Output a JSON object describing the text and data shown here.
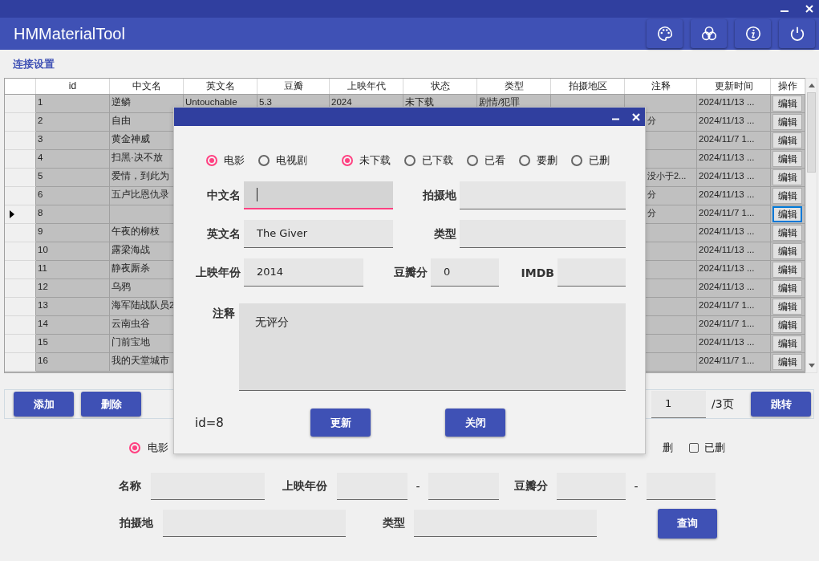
{
  "window": {
    "title": "HMMaterialTool"
  },
  "section_link": "连接设置",
  "table": {
    "columns": [
      "id",
      "中文名",
      "英文名",
      "豆瓣",
      "上映年代",
      "状态",
      "类型",
      "拍摄地区",
      "注释",
      "更新时间",
      "操作"
    ],
    "rows": [
      {
        "id": "1",
        "chinese_name": "逆鳞",
        "english_name": "Untouchable",
        "douban": "5.3",
        "year": "2024",
        "status": "未下载",
        "genre": "剧情/犯罪",
        "updated": "2024/11/13 ...",
        "action": "编辑",
        "current": false
      },
      {
        "id": "2",
        "chinese_name": "自由",
        "note": "分",
        "updated": "2024/11/13 ...",
        "action": "编辑",
        "current": false
      },
      {
        "id": "3",
        "chinese_name": "黄金神威",
        "updated": "2024/11/7 1...",
        "action": "编辑",
        "current": false
      },
      {
        "id": "4",
        "chinese_name": "扫黑·决不放",
        "updated": "2024/11/13 ...",
        "action": "编辑",
        "current": false
      },
      {
        "id": "5",
        "chinese_name": "爱情，到此为",
        "note": "没小于2...",
        "updated": "2024/11/13 ...",
        "action": "编辑",
        "current": false
      },
      {
        "id": "6",
        "chinese_name": "五卢比恩仇录",
        "note": "分",
        "updated": "2024/11/13 ...",
        "action": "编辑",
        "current": false
      },
      {
        "id": "8",
        "note": "分",
        "updated": "2024/11/7 1...",
        "action": "编辑",
        "current": true
      },
      {
        "id": "9",
        "chinese_name": "午夜的柳枝",
        "updated": "2024/11/13 ...",
        "action": "编辑",
        "current": false
      },
      {
        "id": "10",
        "chinese_name": "露梁海战",
        "updated": "2024/11/13 ...",
        "action": "编辑",
        "current": false
      },
      {
        "id": "11",
        "chinese_name": "静夜厮杀",
        "updated": "2024/11/13 ...",
        "action": "编辑",
        "current": false
      },
      {
        "id": "12",
        "chinese_name": "乌鸦",
        "updated": "2024/11/13 ...",
        "action": "编辑",
        "current": false
      },
      {
        "id": "13",
        "chinese_name": "海军陆战队员2",
        "updated": "2024/11/7 1...",
        "action": "编辑",
        "current": false
      },
      {
        "id": "14",
        "chinese_name": "云南虫谷",
        "updated": "2024/11/7 1...",
        "action": "编辑",
        "current": false
      },
      {
        "id": "15",
        "chinese_name": "门前宝地",
        "updated": "2024/11/13 ...",
        "action": "编辑",
        "current": false
      },
      {
        "id": "16",
        "chinese_name": "我的天堂城市",
        "updated": "2024/11/7 1...",
        "action": "编辑",
        "current": false
      }
    ]
  },
  "pager": {
    "buttons": [
      "添加",
      "删除"
    ],
    "page": "1",
    "total": "/3页",
    "jump": "跳转"
  },
  "filter": {
    "type_options": [
      {
        "label": "电影",
        "selected": true
      }
    ],
    "status_options": [
      {
        "kind": "label",
        "label": "删"
      },
      {
        "kind": "checkbox",
        "label": "已删",
        "checked": false
      }
    ],
    "name_label": "名称",
    "year_label": "上映年份",
    "douban_label": "豆瓣分",
    "separators": [
      "-",
      "-"
    ],
    "place_label": "拍摄地",
    "genre_label": "类型",
    "query": "查询"
  },
  "dialog": {
    "type_options": [
      {
        "label": "电影",
        "selected": true
      },
      {
        "label": "电视剧",
        "selected": false
      }
    ],
    "status_options": [
      {
        "label": "未下载",
        "selected": true
      },
      {
        "label": "已下载",
        "selected": false
      },
      {
        "label": "已看",
        "selected": false
      },
      {
        "label": "要删",
        "selected": false
      },
      {
        "label": "已删",
        "selected": false
      }
    ],
    "rows": [
      [
        {
          "label": "中文名",
          "focused": true
        },
        {
          "label": "拍摄地",
          "focused": false
        }
      ],
      [
        {
          "label": "英文名",
          "value": "The Giver",
          "focused": false
        },
        {
          "label": "类型",
          "focused": false
        }
      ],
      [
        {
          "label": "上映年份",
          "value": "2014",
          "focused": false
        },
        {
          "label": "豆瓣分",
          "value": "0",
          "focused": false
        },
        {
          "label": "IMDB",
          "focused": false
        }
      ]
    ],
    "note": {
      "label": "注释",
      "value": "无评分"
    },
    "id_text": "id=8",
    "buttons": [
      "更新",
      "关闭"
    ]
  }
}
